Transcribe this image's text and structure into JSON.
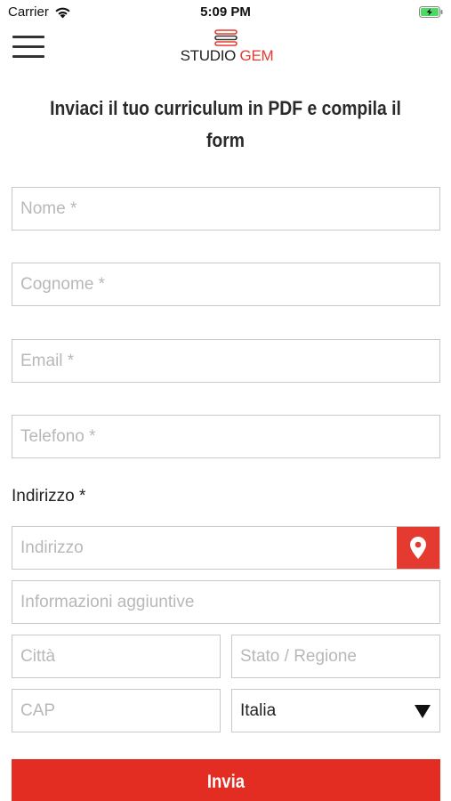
{
  "status_bar": {
    "carrier": "Carrier",
    "time": "5:09 PM",
    "battery_state": "charging"
  },
  "header": {
    "menu_icon": "hamburger-menu-icon",
    "logo": {
      "part1": "STUDIO",
      "part2": "GEM",
      "accent_color": "#e53a2f"
    }
  },
  "page": {
    "title": "Inviaci il tuo curriculum in PDF e compila il form"
  },
  "form": {
    "nome_placeholder": "Nome *",
    "cognome_placeholder": "Cognome *",
    "email_placeholder": "Email *",
    "telefono_placeholder": "Telefono *",
    "indirizzo_label": "Indirizzo *",
    "indirizzo_placeholder": "Indirizzo",
    "location_icon": "map-pin-icon",
    "info_placeholder": "Informazioni aggiuntive",
    "citta_placeholder": "Città",
    "stato_placeholder": "Stato / Regione",
    "cap_placeholder": "CAP",
    "country_selected": "Italia",
    "submit_label": "Invia"
  },
  "colors": {
    "accent": "#e53a2f",
    "button": "#e32c22",
    "border": "#c9c9c9",
    "placeholder": "#b8b8b8"
  }
}
